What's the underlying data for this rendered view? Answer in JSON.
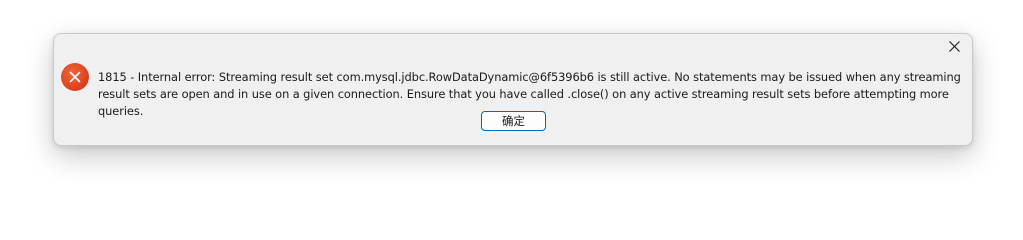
{
  "dialog": {
    "error_icon": "error-circle-icon",
    "close_icon": "close-icon",
    "message": "1815 - Internal error: Streaming result set com.mysql.jdbc.RowDataDynamic@6f5396b6 is still active. No statements may be issued when any streaming result sets are open and in use on a given connection. Ensure that you have called .close() on any active streaming result sets before attempting more queries.",
    "ok_label": "确定"
  },
  "colors": {
    "error_red": "#d9401c",
    "button_border": "#0067c0",
    "dialog_bg": "#f0f0f0"
  }
}
